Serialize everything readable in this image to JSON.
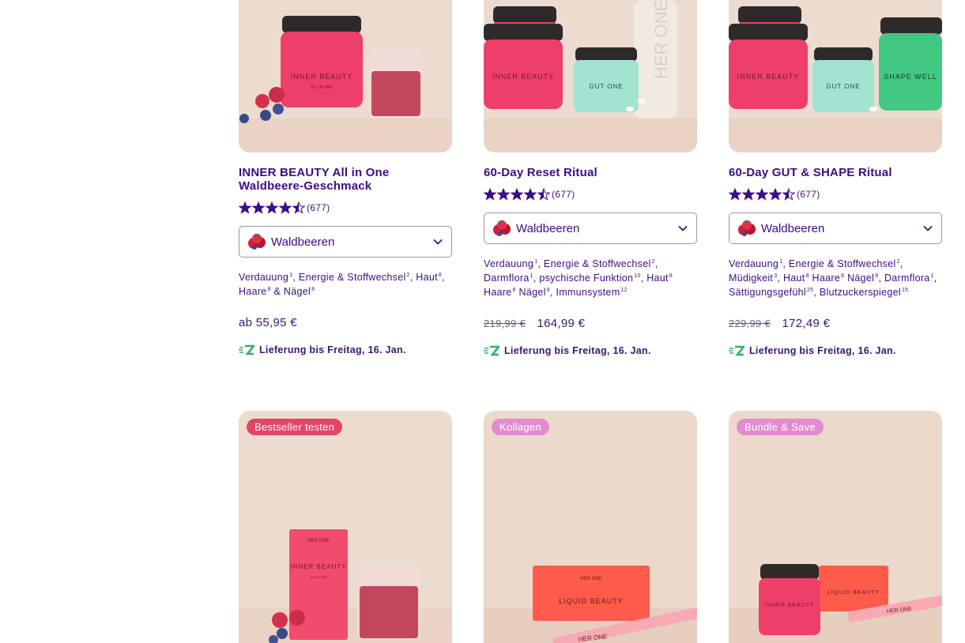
{
  "colors": {
    "accent": "#3d0c88",
    "badge_bestseller": "#e3456a",
    "badge_pink": "#e48ad0",
    "delivery_green": "#2bb36a",
    "product_pink": "#f0426e",
    "product_mint": "#9ee0cf",
    "product_green": "#43c884",
    "product_coral": "#ff5b4c"
  },
  "icons": {
    "star": "star-icon",
    "chevron": "chevron-down-icon",
    "berry": "berry-icon",
    "delivery": "express-delivery-icon"
  },
  "products": [
    {
      "title": "INNER BEAUTY All in One Waldbeere-Geschmack",
      "rating": 4.5,
      "rating_count": "(677)",
      "flavor": "Waldbeeren",
      "benefits": [
        {
          "t": "Verdauung",
          "s": "1"
        },
        {
          "t": ", Energie & Stoffwechsel",
          "s": "2"
        },
        {
          "t": ", Haut",
          "s": "8"
        },
        {
          "t": ", Haare",
          "s": "8"
        },
        {
          "t": " & Nägel",
          "s": "8"
        }
      ],
      "price_old": "",
      "price": "ab 55,95 €",
      "delivery": "Lieferung bis Freitag, 16. Jan.",
      "img_labels": [
        "INNER BEAUTY",
        "ALL IN ONE"
      ]
    },
    {
      "title": "60-Day Reset Ritual",
      "rating": 4.5,
      "rating_count": "(677)",
      "flavor": "Waldbeeren",
      "benefits": [
        {
          "t": "Verdauung",
          "s": "1"
        },
        {
          "t": ", Energie & Stoffwechsel",
          "s": "2"
        },
        {
          "t": ", Darmflora",
          "s": "1"
        },
        {
          "t": ", psychische Funktion",
          "s": "10"
        },
        {
          "t": ", Haut",
          "s": "8"
        },
        {
          "t": " Haare",
          "s": "8"
        },
        {
          "t": " Nägel",
          "s": "8"
        },
        {
          "t": ", Immunsystem",
          "s": "12"
        }
      ],
      "price_old": "219,99 €",
      "price": "164,99 €",
      "delivery": "Lieferung bis Freitag, 16. Jan.",
      "img_labels": [
        "INNER BEAUTY",
        "GUT ONE",
        "HER ONE"
      ]
    },
    {
      "title": "60-Day GUT & SHAPE Ritual",
      "rating": 4.5,
      "rating_count": "(677)",
      "flavor": "Waldbeeren",
      "benefits": [
        {
          "t": "Verdauung",
          "s": "1"
        },
        {
          "t": ", Energie & Stoffwechsel",
          "s": "2"
        },
        {
          "t": ", Müdigkeit",
          "s": "3"
        },
        {
          "t": ", Haut",
          "s": "8"
        },
        {
          "t": " Haare",
          "s": "8"
        },
        {
          "t": " Nägel",
          "s": "8"
        },
        {
          "t": ", Darmflora",
          "s": "1"
        },
        {
          "t": ", Sättigungsgefühl",
          "s": "25"
        },
        {
          "t": ", Blutzuckerspiegel",
          "s": "15"
        }
      ],
      "price_old": "229,99 €",
      "price": "172,49 €",
      "delivery": "Lieferung bis Freitag, 16. Jan.",
      "img_labels": [
        "INNER BEAUTY",
        "GUT ONE",
        "SHAPE WELL"
      ]
    },
    {
      "badge": "Bestseller testen",
      "img_labels": [
        "HER ONE",
        "INNER BEAUTY",
        "ALL IN ONE"
      ]
    },
    {
      "badge": "Kollagen",
      "img_labels": [
        "HER ONE",
        "LIQUID BEAUTY",
        "HER ONE"
      ]
    },
    {
      "badge": "Bundle & Save",
      "img_labels": [
        "INNER BEAUTY",
        "LIQUID BEAUTY",
        "HER ONE"
      ]
    }
  ]
}
